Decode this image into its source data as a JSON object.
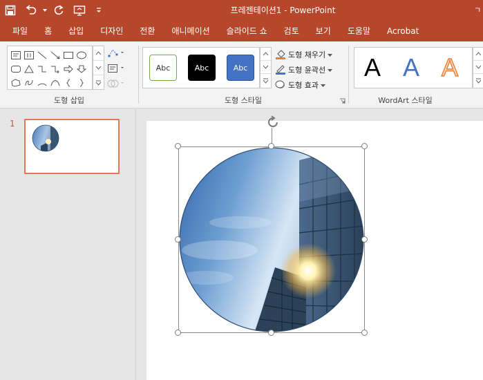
{
  "window": {
    "title": "프레젠테이션1 - PowerPoint",
    "title_right": "ㄱ"
  },
  "qat": {
    "save_icon": "save-icon",
    "undo_icon": "undo-icon",
    "redo_icon": "redo-icon",
    "slideshow_icon": "present-from-start-icon",
    "customize_icon": "customize-qat-icon"
  },
  "tabs": [
    "파일",
    "홈",
    "삽입",
    "디자인",
    "전환",
    "애니메이션",
    "슬라이드 쇼",
    "검토",
    "보기",
    "도움말",
    "Acrobat"
  ],
  "ribbon": {
    "insert_shapes_label": "도형 삽입",
    "shape_styles_label": "도형 스타일",
    "wordart_styles_label": "WordArt 스타일",
    "style_buttons": [
      "Abc",
      "Abc",
      "Abc"
    ],
    "shape_fill": "도형 채우기",
    "shape_outline": "도형 윤곽선",
    "shape_effects": "도형 효과",
    "wordart_letters": [
      "A",
      "A",
      "A"
    ]
  },
  "colors": {
    "accent": "#b7472a",
    "thumb_border": "#e0765a",
    "style_outline_green": "#70ad47",
    "style_black": "#000000",
    "style_blue": "#4472c4",
    "wordart_blue": "#4472c4",
    "wordart_orange": "#ed7d31"
  },
  "thumbnails": {
    "slide_number": "1"
  }
}
